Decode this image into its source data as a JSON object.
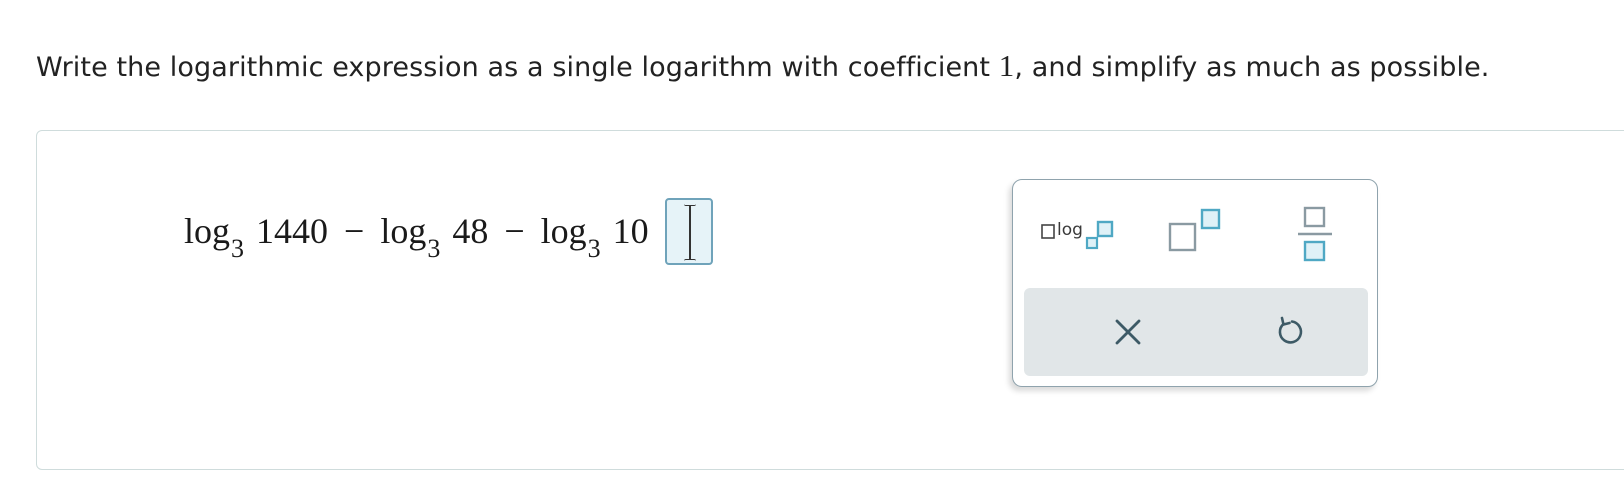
{
  "prompt": {
    "before": "Write the logarithmic expression as a single logarithm with coefficient ",
    "number": "1",
    "after": ", and simplify as much as possible."
  },
  "equation": {
    "terms": [
      {
        "func": "log",
        "base": "3",
        "arg": "1440"
      },
      {
        "func": "log",
        "base": "3",
        "arg": "48"
      },
      {
        "func": "log",
        "base": "3",
        "arg": "10"
      }
    ],
    "operators": [
      "−",
      "−"
    ],
    "equals": "="
  },
  "answer": {
    "value": ""
  },
  "palette": {
    "log_button_text": "log",
    "icons": [
      "log-base-icon",
      "exponent-icon",
      "fraction-icon",
      "clear-icon",
      "undo-icon"
    ],
    "colors": {
      "accent": "#4fa8c4",
      "box_fill": "#dff1f7",
      "gray": "#8a9aa2",
      "bar_bg": "#e1e6e8"
    }
  }
}
